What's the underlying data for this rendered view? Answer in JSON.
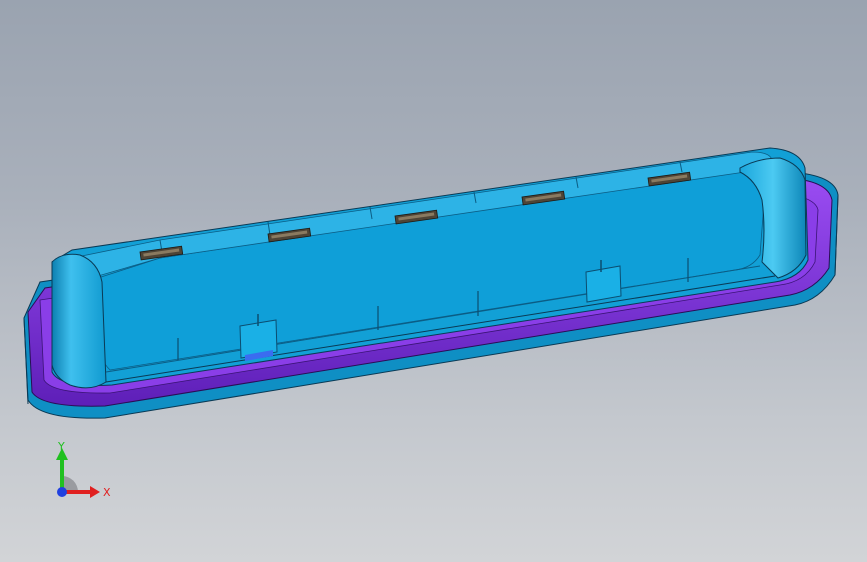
{
  "viewport": {
    "background_top": "#9aa3b0",
    "background_bottom": "#d2d4d7"
  },
  "model": {
    "body_color": "#13a3db",
    "inner_color": "#0f9fd8",
    "rim_color": "#7d2ee0",
    "clip_color": "#5a4a3a"
  },
  "triad": {
    "x_label": "X",
    "y_label": "Y",
    "x_color": "#e02020",
    "y_color": "#20c020",
    "z_color": "#2040e0"
  }
}
